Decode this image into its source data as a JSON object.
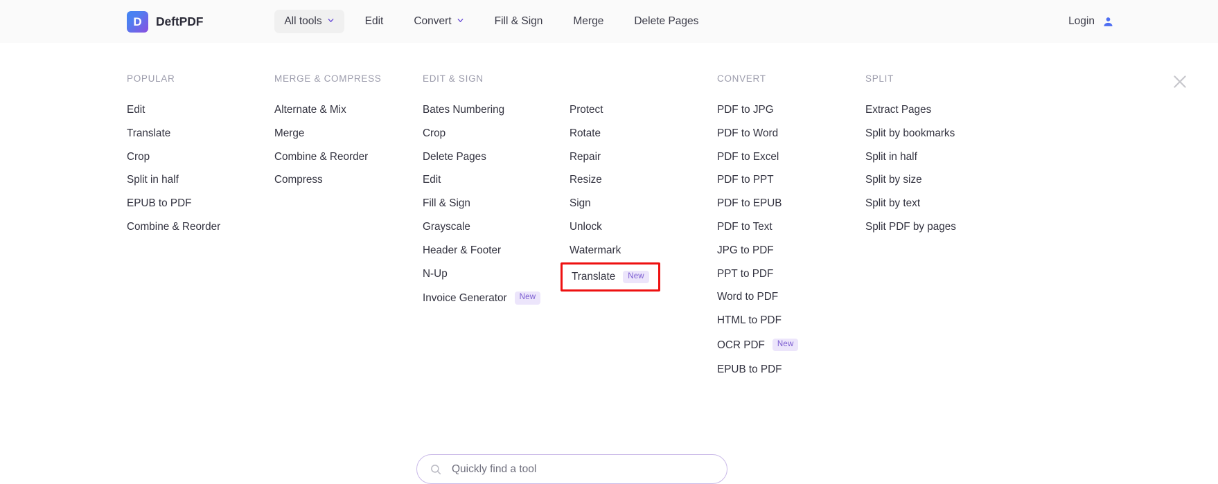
{
  "header": {
    "logo_letter": "D",
    "brand_name": "DeftPDF",
    "nav_items": [
      {
        "label": "All tools",
        "has_chevron": true,
        "active": true
      },
      {
        "label": "Edit",
        "has_chevron": false,
        "active": false
      },
      {
        "label": "Convert",
        "has_chevron": true,
        "active": false
      },
      {
        "label": "Fill & Sign",
        "has_chevron": false,
        "active": false
      },
      {
        "label": "Merge",
        "has_chevron": false,
        "active": false
      },
      {
        "label": "Delete Pages",
        "has_chevron": false,
        "active": false
      }
    ],
    "login_label": "Login",
    "login_icon": "person-icon"
  },
  "mega_menu": {
    "close_icon": "close-icon",
    "columns": [
      {
        "heading": "POPULAR",
        "items": [
          {
            "label": "Edit"
          },
          {
            "label": "Translate"
          },
          {
            "label": "Crop"
          },
          {
            "label": "Split in half"
          },
          {
            "label": "EPUB to PDF"
          },
          {
            "label": "Combine & Reorder"
          }
        ]
      },
      {
        "heading": "MERGE & COMPRESS",
        "items": [
          {
            "label": "Alternate & Mix"
          },
          {
            "label": "Merge"
          },
          {
            "label": "Combine & Reorder"
          },
          {
            "label": "Compress"
          }
        ]
      },
      {
        "heading": "EDIT & SIGN",
        "items": [
          {
            "label": "Bates Numbering"
          },
          {
            "label": "Crop"
          },
          {
            "label": "Delete Pages"
          },
          {
            "label": "Edit"
          },
          {
            "label": "Fill & Sign"
          },
          {
            "label": "Grayscale"
          },
          {
            "label": "Header & Footer"
          },
          {
            "label": "N-Up"
          },
          {
            "label": "Invoice Generator",
            "badge": "New"
          }
        ]
      },
      {
        "heading": "",
        "items": [
          {
            "label": "Protect"
          },
          {
            "label": "Rotate"
          },
          {
            "label": "Repair"
          },
          {
            "label": "Resize"
          },
          {
            "label": "Sign"
          },
          {
            "label": "Unlock"
          },
          {
            "label": "Watermark"
          },
          {
            "label": "Translate",
            "badge": "New",
            "highlighted": true
          }
        ]
      },
      {
        "heading": "CONVERT",
        "items": [
          {
            "label": "PDF to JPG"
          },
          {
            "label": "PDF to Word"
          },
          {
            "label": "PDF to Excel"
          },
          {
            "label": "PDF to PPT"
          },
          {
            "label": "PDF to EPUB"
          },
          {
            "label": "PDF to Text"
          },
          {
            "label": "JPG to PDF"
          },
          {
            "label": "PPT to PDF"
          },
          {
            "label": "Word to PDF"
          },
          {
            "label": "HTML to PDF"
          },
          {
            "label": "OCR PDF",
            "badge": "New"
          },
          {
            "label": "EPUB to PDF"
          }
        ]
      },
      {
        "heading": "SPLIT",
        "items": [
          {
            "label": "Extract Pages"
          },
          {
            "label": "Split by bookmarks"
          },
          {
            "label": "Split in half"
          },
          {
            "label": "Split by size"
          },
          {
            "label": "Split by text"
          },
          {
            "label": "Split PDF by pages"
          }
        ]
      }
    ]
  },
  "search": {
    "placeholder": "Quickly find a tool",
    "value": "",
    "icon": "search-icon"
  },
  "colors": {
    "accent_purple": "#7a5bd0",
    "badge_bg": "#ece5fb",
    "highlight_red": "#ee1111",
    "header_bg": "#fafafa",
    "heading_gray": "#9b9bab"
  }
}
